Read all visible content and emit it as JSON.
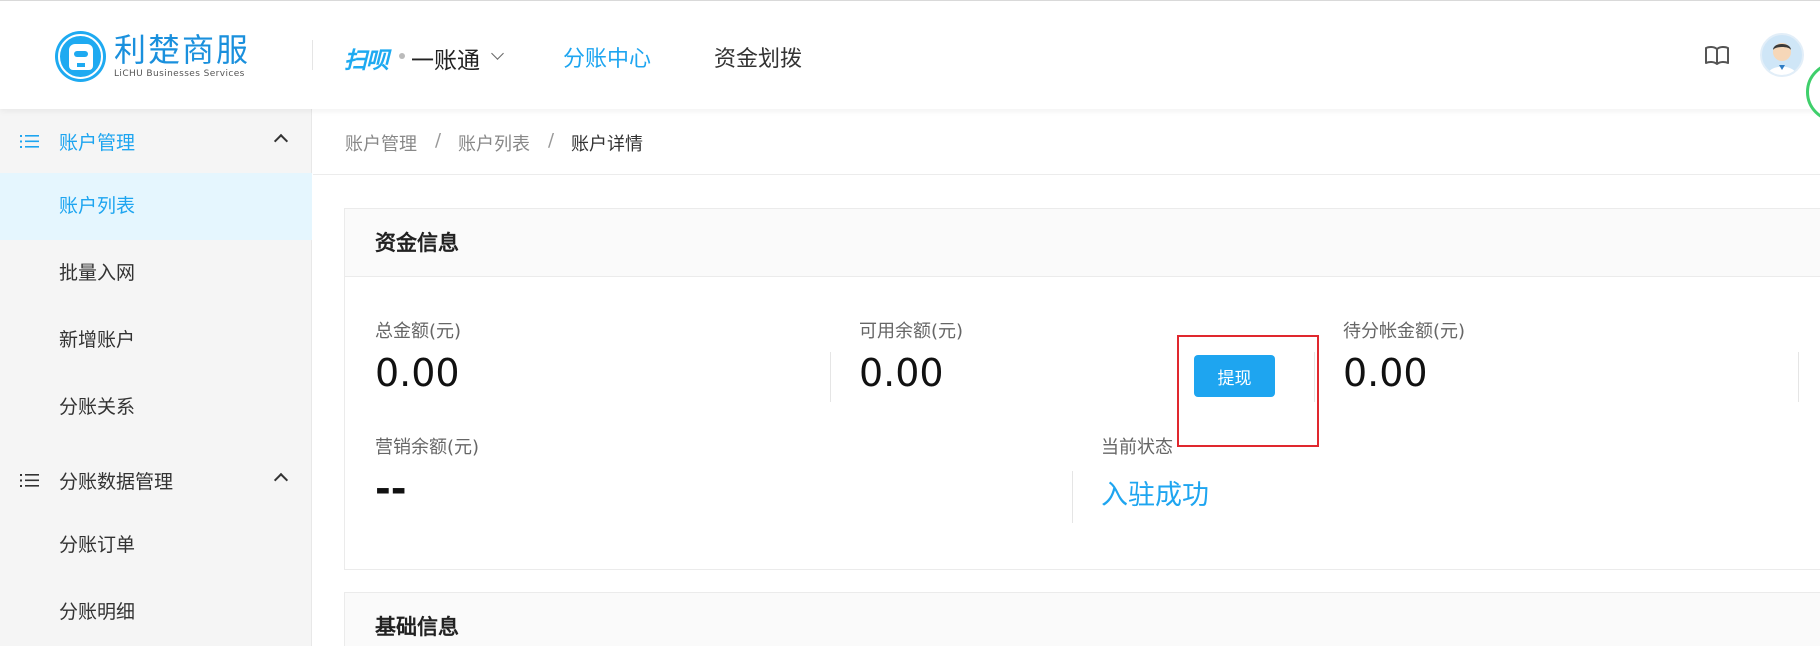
{
  "header": {
    "logo_cn": "利楚商服",
    "logo_en": "LiCHU Businesses Services",
    "brand": "扫呗",
    "product": "一账通",
    "nav": [
      {
        "label": "分账中心",
        "active": true
      },
      {
        "label": "资金划拨",
        "active": false
      }
    ],
    "icons": {
      "docs": "book-icon",
      "user": "avatar"
    }
  },
  "sidebar": {
    "groups": [
      {
        "label": "账户管理",
        "expanded": true,
        "items": [
          {
            "label": "账户列表",
            "active": true
          },
          {
            "label": "批量入网",
            "active": false
          },
          {
            "label": "新增账户",
            "active": false
          },
          {
            "label": "分账关系",
            "active": false
          }
        ]
      },
      {
        "label": "分账数据管理",
        "expanded": true,
        "items": [
          {
            "label": "分账订单",
            "active": false
          },
          {
            "label": "分账明细",
            "active": false
          }
        ]
      }
    ]
  },
  "breadcrumb": [
    "账户管理",
    "账户列表",
    "账户详情"
  ],
  "breadcrumb_separator": "/",
  "fund_card": {
    "title": "资金信息",
    "total": {
      "label": "总金额(元)",
      "value": "0.00"
    },
    "available": {
      "label": "可用余额(元)",
      "value": "0.00"
    },
    "withdraw_label": "提现",
    "pending": {
      "label": "待分帐金额(元)",
      "value": "0.00"
    },
    "marketing": {
      "label": "营销余额(元)",
      "value": "--"
    },
    "status": {
      "label": "当前状态",
      "value": "入驻成功"
    }
  },
  "basic_card": {
    "title": "基础信息"
  },
  "colors": {
    "accent": "#1ea5f0",
    "highlight_box": "#e0282e",
    "sidebar_bg": "#f5f5f5",
    "active_item_bg": "#e5f6fe"
  }
}
